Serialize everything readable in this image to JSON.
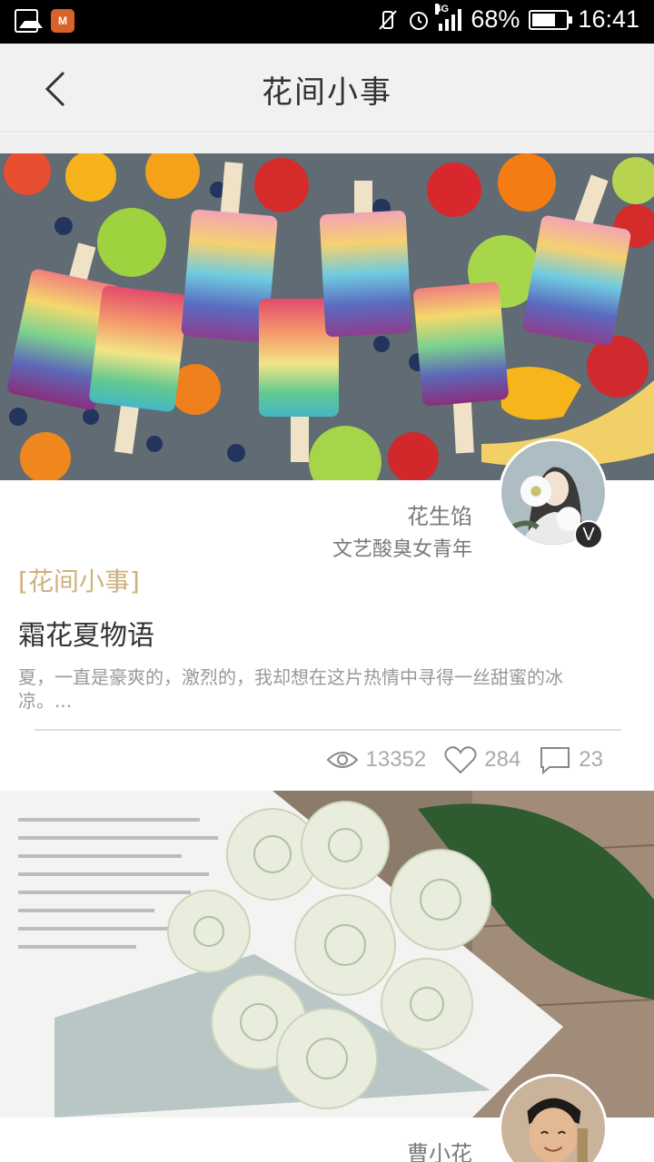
{
  "status_bar": {
    "battery_percent": "68%",
    "time": "16:41",
    "network": "4G",
    "battery_level": 0.68
  },
  "header": {
    "title": "花间小事"
  },
  "posts": [
    {
      "author_name": "花生馅",
      "author_bio": "文艺酸臭女青年",
      "verified_badge": "V",
      "category": "[花间小事]",
      "title": "霜花夏物语",
      "excerpt": "夏，一直是豪爽的，激烈的，我却想在这片热情中寻得一丝甜蜜的冰凉。...",
      "views": "13352",
      "likes": "284",
      "comments": "23"
    },
    {
      "author_name": "曹小花"
    }
  ],
  "colors": {
    "accent_category": "#cfb07a",
    "text_primary": "#333333",
    "text_secondary": "#999999",
    "header_bg": "#f1f1f1"
  },
  "icons": [
    "gallery-icon",
    "app-icon",
    "vibrate-icon",
    "alarm-icon",
    "signal-icon",
    "battery-icon",
    "back-icon",
    "eye-icon",
    "heart-icon",
    "comment-icon",
    "verified-icon"
  ]
}
